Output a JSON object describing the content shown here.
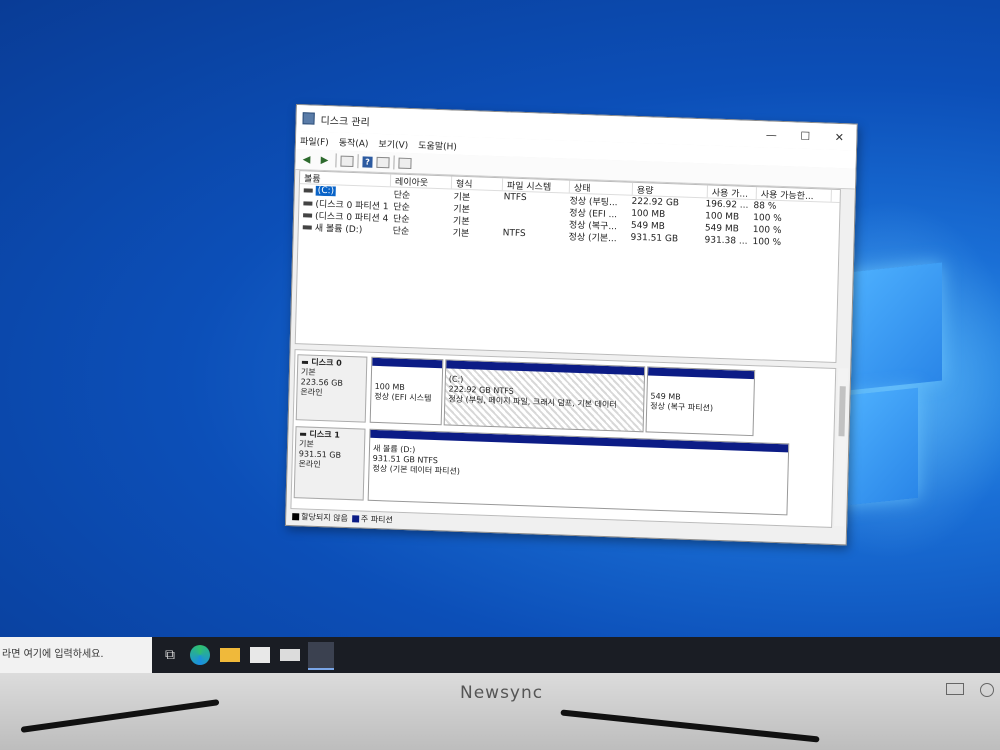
{
  "window": {
    "title": "디스크 관리",
    "controls": {
      "minimize": "—",
      "maximize": "☐",
      "close": "✕"
    }
  },
  "menu": [
    "파일(F)",
    "동작(A)",
    "보기(V)",
    "도움말(H)"
  ],
  "table": {
    "headers": [
      "볼륨",
      "레이아웃",
      "형식",
      "파일 시스템",
      "상태",
      "용량",
      "사용 가...",
      "사용 가능한..."
    ],
    "rows": [
      [
        "(C:)",
        "단순",
        "기본",
        "NTFS",
        "정상 (부팅...",
        "222.92 GB",
        "196.92 ...",
        "88 %"
      ],
      [
        "(디스크 0 파티션 1)",
        "단순",
        "기본",
        "",
        "정상 (EFI ...",
        "100 MB",
        "100 MB",
        "100 %"
      ],
      [
        "(디스크 0 파티션 4)",
        "단순",
        "기본",
        "",
        "정상 (복구...",
        "549 MB",
        "549 MB",
        "100 %"
      ],
      [
        "새 볼륨 (D:)",
        "단순",
        "기본",
        "NTFS",
        "정상 (기본...",
        "931.51 GB",
        "931.38 ...",
        "100 %"
      ]
    ]
  },
  "disks": [
    {
      "name": "디스크 0",
      "type": "기본",
      "size": "223.56 GB",
      "status": "온라인",
      "partitions": [
        {
          "line1": "100 MB",
          "line2": "정상 (EFI 시스템"
        },
        {
          "title": "(C:)",
          "line1": "222.92 GB NTFS",
          "line2": "정상 (부팅, 페이지 파일, 크래시 덤프, 기본 데이터"
        },
        {
          "line1": "549 MB",
          "line2": "정상 (복구 파티션)"
        }
      ]
    },
    {
      "name": "디스크 1",
      "type": "기본",
      "size": "931.51 GB",
      "status": "온라인",
      "partitions": [
        {
          "title": "새 볼륨 (D:)",
          "line1": "931.51 GB NTFS",
          "line2": "정상 (기본 데이터 파티션)"
        }
      ]
    }
  ],
  "legend": {
    "unallocated": "할당되지 않음",
    "primary": "주 파티션",
    "unallocated_color": "#000000",
    "primary_color": "#0c1c86"
  },
  "taskbar": {
    "search_placeholder": "라면 여기에 입력하세요."
  },
  "monitor": {
    "brand": "Newsync"
  },
  "colors": {
    "desktop": "#0c4fb8",
    "selection": "#0a64c8"
  }
}
